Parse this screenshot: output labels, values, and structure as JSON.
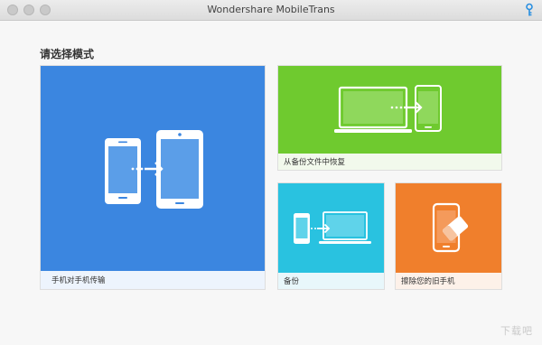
{
  "window": {
    "title": "Wondershare MobileTrans"
  },
  "main": {
    "section_title": "请选择模式",
    "tiles": [
      {
        "label": "手机对手机传输",
        "color": "#3b86e0",
        "icon": "phone-to-phone-icon"
      },
      {
        "label": "从备份文件中恢复",
        "color": "#6fca2f",
        "icon": "laptop-to-phone-icon"
      },
      {
        "label": "备份",
        "color": "#29c2e0",
        "icon": "phone-to-laptop-icon"
      },
      {
        "label": "擦除您的旧手机",
        "color": "#f07f2c",
        "icon": "phone-eraser-icon"
      }
    ]
  },
  "watermark": "下载吧"
}
